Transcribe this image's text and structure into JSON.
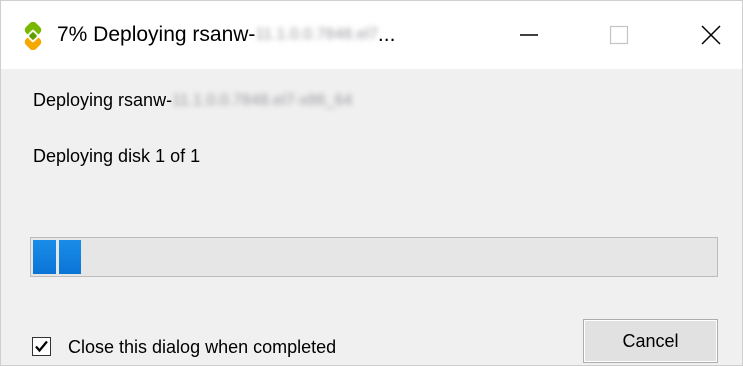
{
  "window": {
    "title_prefix": "7% Deploying rsanw-",
    "title_blurred": "11.1.0.0.7848.el7",
    "title_suffix": "..."
  },
  "controls": {
    "minimize_icon": "minimize-icon",
    "maximize_icon": "maximize-icon",
    "close_icon": "close-icon"
  },
  "content": {
    "deploying_prefix": "Deploying rsanw-",
    "deploying_blurred": "11.1.0.0.7848.el7-x86_64",
    "disk_status": "Deploying disk 1 of 1",
    "progress_percent": 7
  },
  "footer": {
    "checkbox_checked": true,
    "checkbox_label": "Close this dialog when completed",
    "cancel_label": "Cancel"
  },
  "colors": {
    "progress_fill": "#0a74d6",
    "icon_green": "#7ab800",
    "icon_yellow": "#f5a800"
  }
}
